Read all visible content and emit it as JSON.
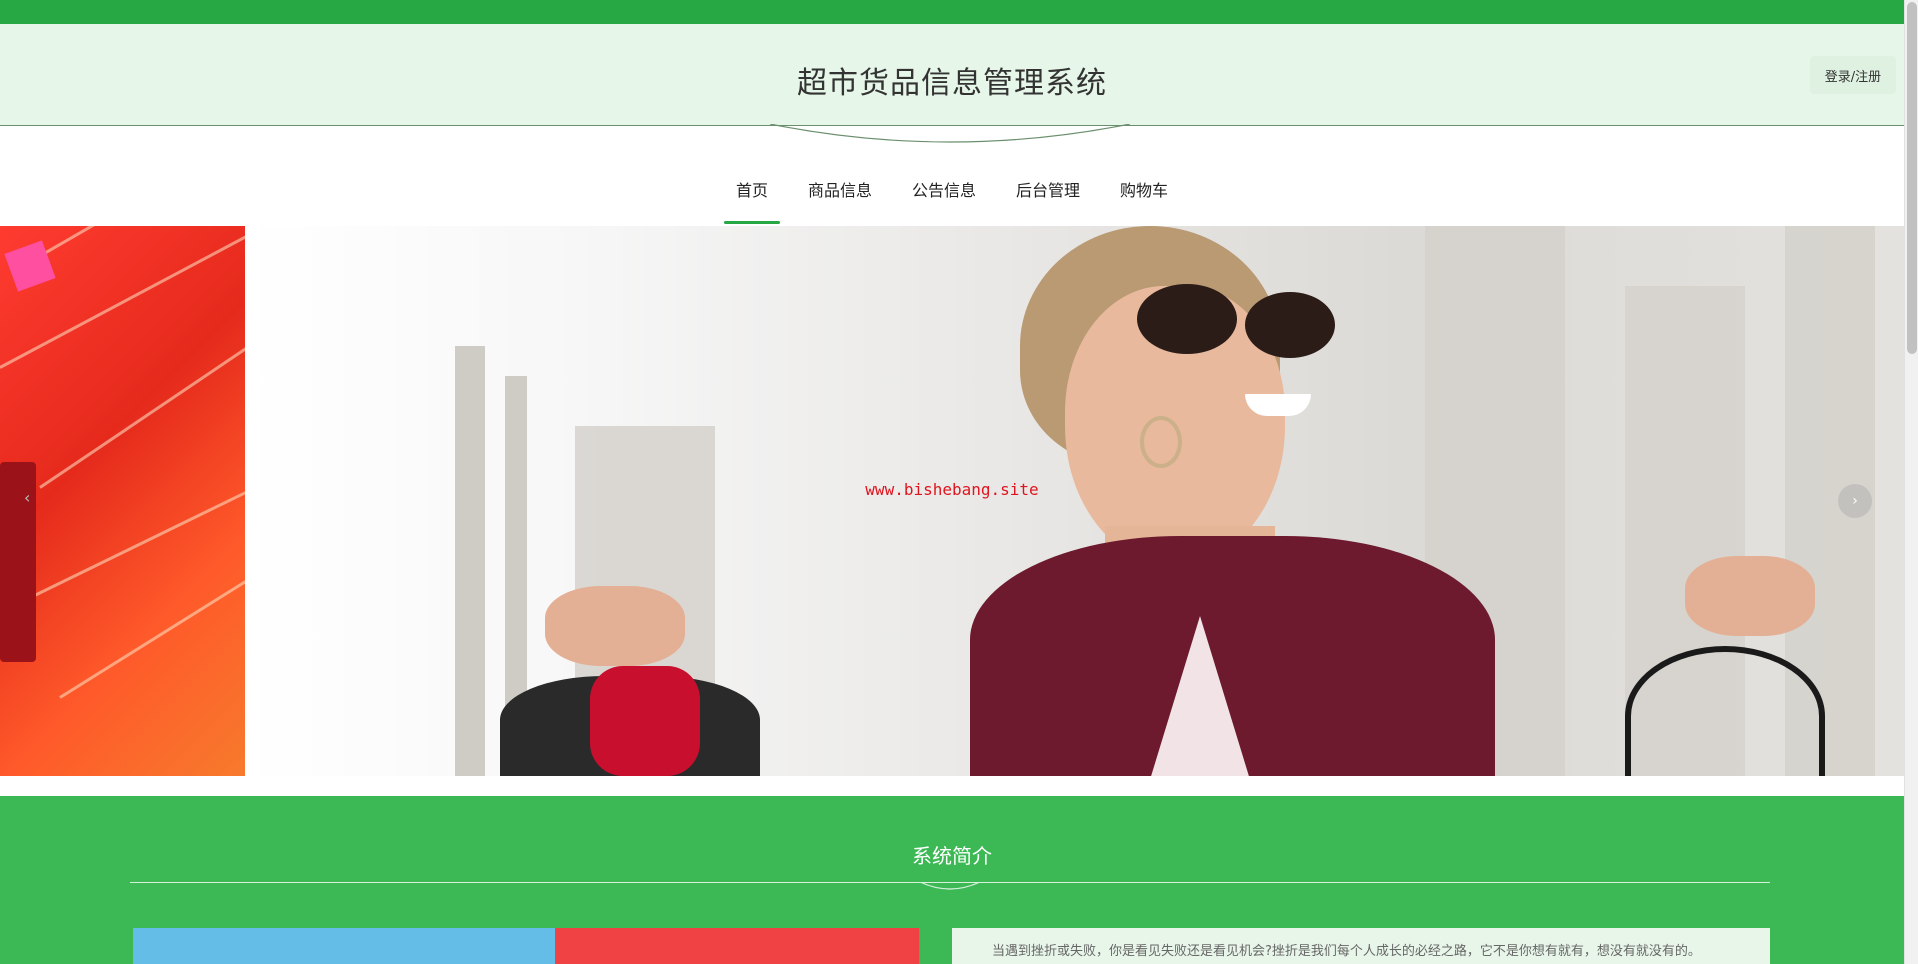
{
  "header": {
    "title": "超市货品信息管理系统",
    "login_label": "登录/注册"
  },
  "nav": {
    "items": [
      {
        "label": "首页",
        "active": true
      },
      {
        "label": "商品信息"
      },
      {
        "label": "公告信息"
      },
      {
        "label": "后台管理"
      },
      {
        "label": "购物车"
      }
    ]
  },
  "carousel": {
    "watermark": "www.bishebang.site",
    "prev_icon": "chevron-left-icon",
    "next_icon": "chevron-right-icon"
  },
  "intro": {
    "title": "系统简介",
    "text": "当遇到挫折或失败，你是看见失败还是看见机会?挫折是我们每个人成长的必经之路，它不是你想有就有，想没有就没有的。"
  },
  "colors": {
    "brand_green": "#28a745",
    "section_green": "#3cb855",
    "header_bg": "#e6f6e8"
  }
}
